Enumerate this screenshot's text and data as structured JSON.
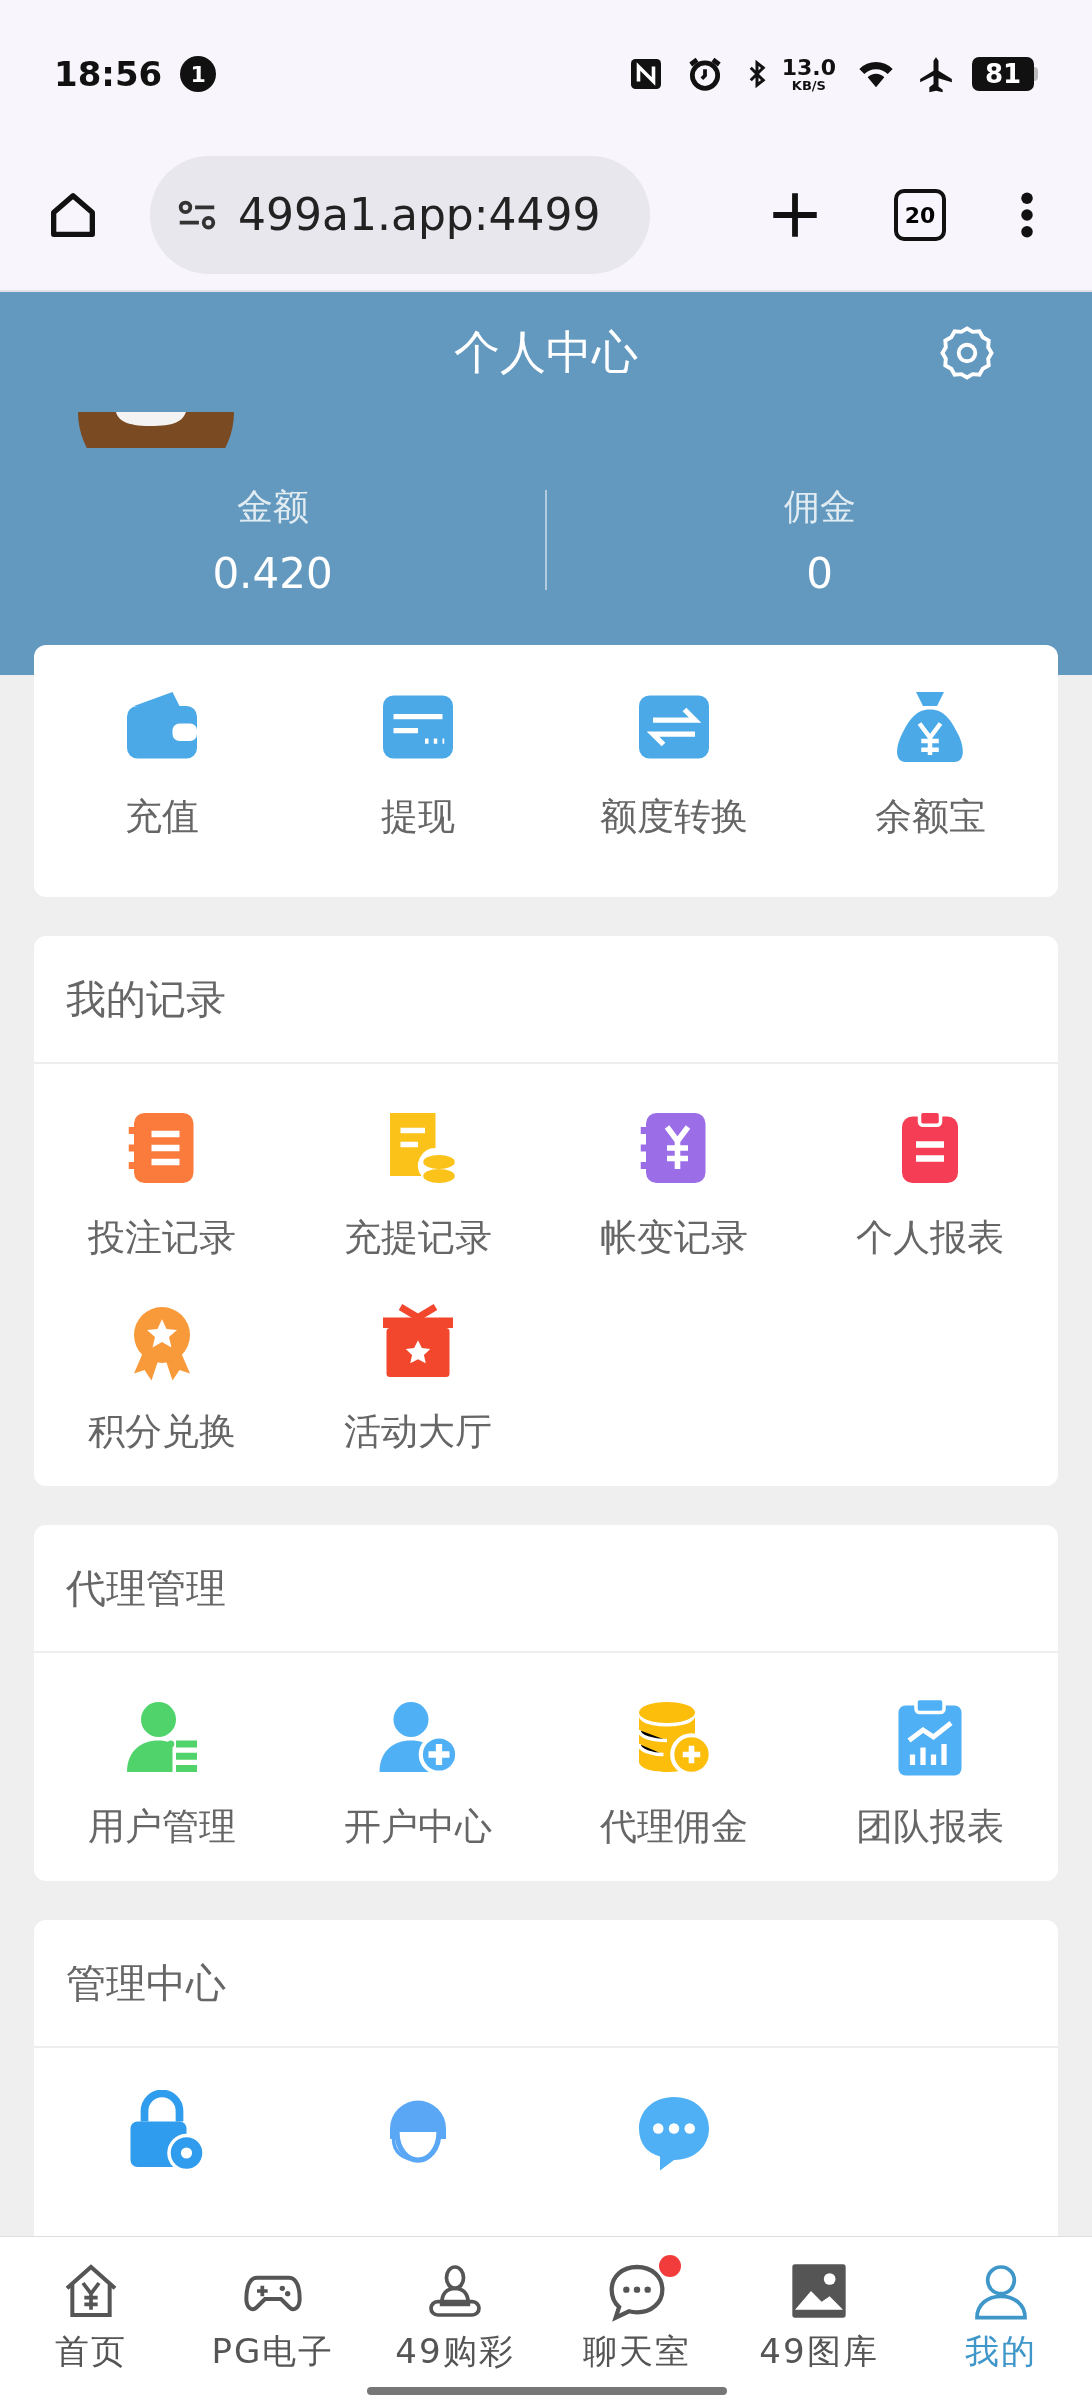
{
  "status_bar": {
    "time": "18:56",
    "notification_count": "1",
    "net_speed": "13.0",
    "net_unit": "KB/S",
    "battery": "81"
  },
  "browser": {
    "url": "499a1.app:4499",
    "tab_count": "20"
  },
  "header": {
    "title": "个人中心",
    "stats": [
      {
        "label": "金额",
        "value": "0.420"
      },
      {
        "label": "佣金",
        "value": "0"
      }
    ]
  },
  "wallet_actions": [
    "充值",
    "提现",
    "额度转换",
    "余额宝"
  ],
  "sections": [
    {
      "title": "我的记录",
      "items": [
        "投注记录",
        "充提记录",
        "帐变记录",
        "个人报表",
        "积分兑换",
        "活动大厅"
      ]
    },
    {
      "title": "代理管理",
      "items": [
        "用户管理",
        "开户中心",
        "代理佣金",
        "团队报表"
      ]
    },
    {
      "title": "管理中心"
    }
  ],
  "bottom_nav": [
    {
      "label": "首页",
      "selected": false,
      "dot": false
    },
    {
      "label": "PG电子",
      "selected": false,
      "dot": false
    },
    {
      "label": "49购彩",
      "selected": false,
      "dot": false
    },
    {
      "label": "聊天室",
      "selected": false,
      "dot": true
    },
    {
      "label": "49图库",
      "selected": false,
      "dot": false
    },
    {
      "label": "我的",
      "selected": true,
      "dot": false
    }
  ]
}
